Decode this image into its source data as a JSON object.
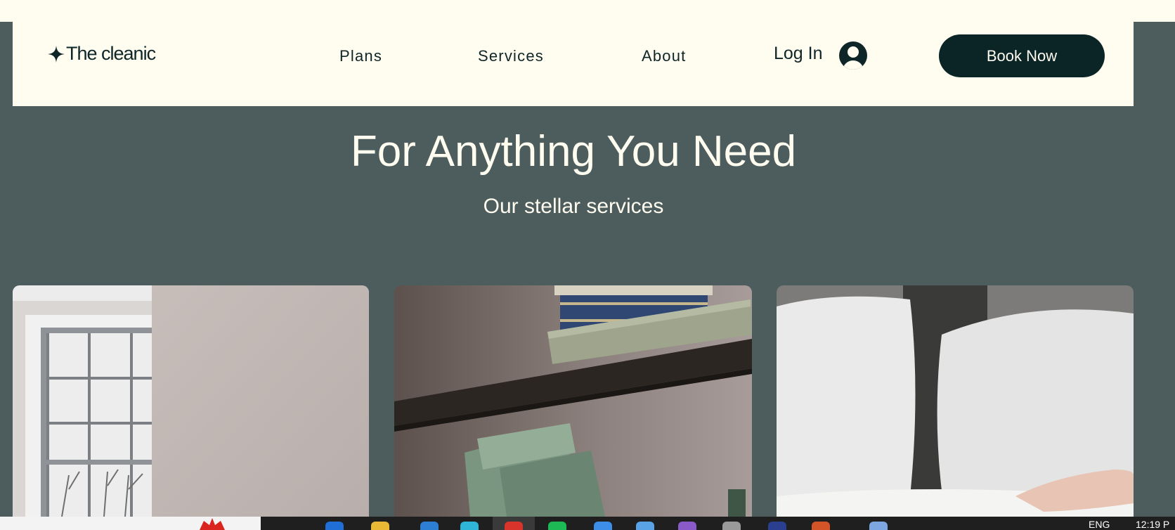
{
  "header": {
    "logo_text": "The cleanic",
    "nav": [
      "Plans",
      "Services",
      "About"
    ],
    "login_label": "Log In",
    "book_label": "Book Now"
  },
  "hero": {
    "title": "For Anything You Need",
    "subtitle": "Our stellar services"
  },
  "cards": [
    {
      "image": "window-wall-photo"
    },
    {
      "image": "bookshelf-photo"
    },
    {
      "image": "pillows-bed-photo"
    }
  ],
  "taskbar": {
    "language": "ENG",
    "time": "12:19 P"
  },
  "colors": {
    "page_background": "#4d5c5d",
    "header_background": "#fffcf0",
    "brand_dark": "#0b2426",
    "text_light": "#fffcf0"
  }
}
